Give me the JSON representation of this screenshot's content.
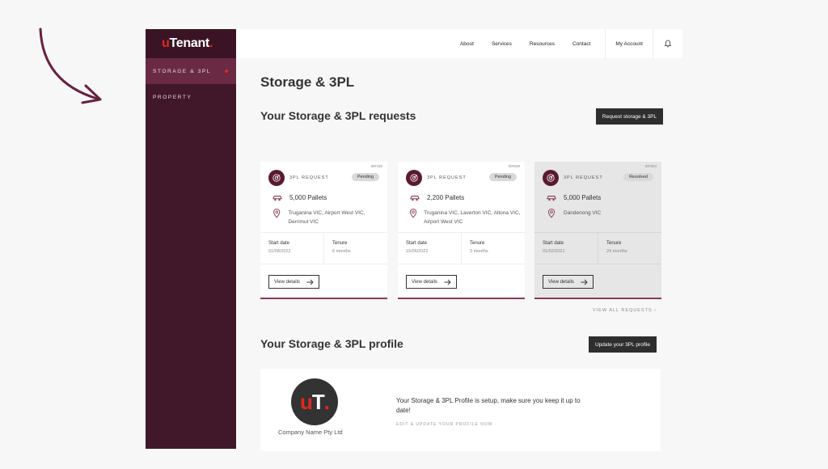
{
  "brand": {
    "logo_prefix": "u",
    "logo_main": "Tenant",
    "logo_dot": "."
  },
  "sidebar": {
    "items": [
      {
        "label": "STORAGE & 3PL",
        "active": true
      },
      {
        "label": "PROPERTY",
        "active": false
      }
    ]
  },
  "topbar": {
    "nav": [
      "About",
      "Services",
      "Resources",
      "Contact"
    ],
    "account_label": "My Account",
    "bell_icon": "bell-icon"
  },
  "main": {
    "page_title": "Storage & 3PL",
    "requests_title": "Your Storage & 3PL requests",
    "request_button": "Request storage & 3PL",
    "view_all": "VIEW ALL REQUESTS ›",
    "requests": [
      {
        "id": "ID#436",
        "type": "3PL REQUEST",
        "status": "Pending",
        "pallets": "5,000 Pallets",
        "locations": "Truganina VIC, Airport West VIC, Derrimut VIC",
        "start_label": "Start date",
        "start_value": "01/08/2022",
        "tenure_label": "Tenure",
        "tenure_value": "6 months",
        "view_label": "View details"
      },
      {
        "id": "ID#539",
        "type": "3PL REQUEST",
        "status": "Pending",
        "pallets": "2,200 Pallets",
        "locations": "Truganina VIC, Laverton VIC, Altona VIC, Airport West VIC",
        "start_label": "Start date",
        "start_value": "15/06/2022",
        "tenure_label": "Tenure",
        "tenure_value": "3 months",
        "view_label": "View details"
      },
      {
        "id": "ID#304",
        "type": "3PL REQUEST",
        "status": "Resolved",
        "pallets": "5,000 Pallets",
        "locations": "Dandenong VIC",
        "start_label": "Start date",
        "start_value": "01/02/2021",
        "tenure_label": "Tenure",
        "tenure_value": "24 months",
        "view_label": "View details"
      }
    ],
    "profile_title": "Your Storage & 3PL profile",
    "profile_button": "Update your 3PL profile",
    "profile": {
      "avatar_u": "u",
      "avatar_t": "T",
      "avatar_dot": ".",
      "company": "Company Name Pty Ltd",
      "message": "Your Storage & 3PL Profile is setup, make sure you keep it up to date!",
      "edit_link": "EDIT & UPDATE YOUR PROFILE NOW"
    }
  },
  "colors": {
    "sidebar": "#41172a",
    "sidebar_active": "#6a2a44",
    "accent": "#e3261f",
    "card_border": "#8a3b54"
  }
}
